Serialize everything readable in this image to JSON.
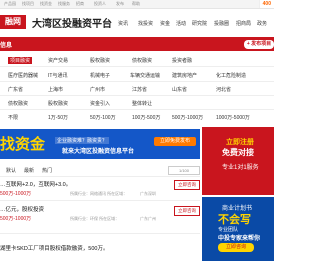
{
  "topbar": {
    "links": [
      "产品园",
      "找项目",
      "找资金",
      "找服务",
      "招商",
      "投资人",
      "发布",
      "帮助"
    ],
    "hotline": "400"
  },
  "header": {
    "logo": "融网",
    "site_title": "大湾区投融资平台",
    "nav": [
      "资讯",
      "找投资",
      "资金",
      "活动",
      "研究院",
      "投融圈",
      "招商局",
      "政务",
      "数字化",
      "创新"
    ],
    "nav_labels_chev": "▾"
  },
  "navbar": {
    "title": "信息",
    "publish": "+ 发布项目"
  },
  "filters": {
    "row1": [
      "项目融资",
      "资产交易",
      "股权融资",
      "债权融资",
      "投资者融"
    ],
    "row2": [
      "医疗医药器械",
      "IT与通讯",
      "机械电子",
      "车辆交通运输",
      "建筑房地产",
      "化工危险制造"
    ],
    "row3": [
      "广东省",
      "上海市",
      "广州市",
      "江苏省",
      "山东省",
      "河北省"
    ],
    "row4": [
      "债权融资",
      "股权融资",
      "资金引入",
      "整体转让"
    ],
    "row5": [
      "不限",
      "1万-50万",
      "50万-100万",
      "100万-500万",
      "500万-1000万",
      "1000万-5000万"
    ],
    "active": "项目融资"
  },
  "banner": {
    "big": "找资金",
    "sub1": "企业融资难？融资贵？",
    "sub2": "就来大湾区投融资信息平台",
    "cta": "立即免费发布"
  },
  "side_ad_1": {
    "line1": "立即注册",
    "line2": "免费对接",
    "line3": "专业1对1服务"
  },
  "side_ad_2": {
    "line1": "商业计划书",
    "line2": "不会写",
    "line3": "专业团队",
    "line4": "中投专家来帮你",
    "cta": "立即咨询"
  },
  "sort": {
    "labels": [
      "默认",
      "最新",
      "热门"
    ],
    "page": "1/100"
  },
  "listings": [
    {
      "title": "…互联网+2.0，互联网+3.0。",
      "money": "500万-1000万",
      "meta": "所属行业：网络通讯  所在区域：",
      "region": "广东深圳",
      "btn": "立即咨询"
    },
    {
      "title": "…亿元，股权投资",
      "money": "500万-1000万",
      "meta": "所属行业：环保  所在区域：",
      "region": "广东广州",
      "btn": "立即咨询"
    },
    {
      "title": "湖里卡SKD工厂项目股权借款融资，500万。",
      "money": "",
      "meta": "",
      "region": "",
      "btn": ""
    }
  ]
}
